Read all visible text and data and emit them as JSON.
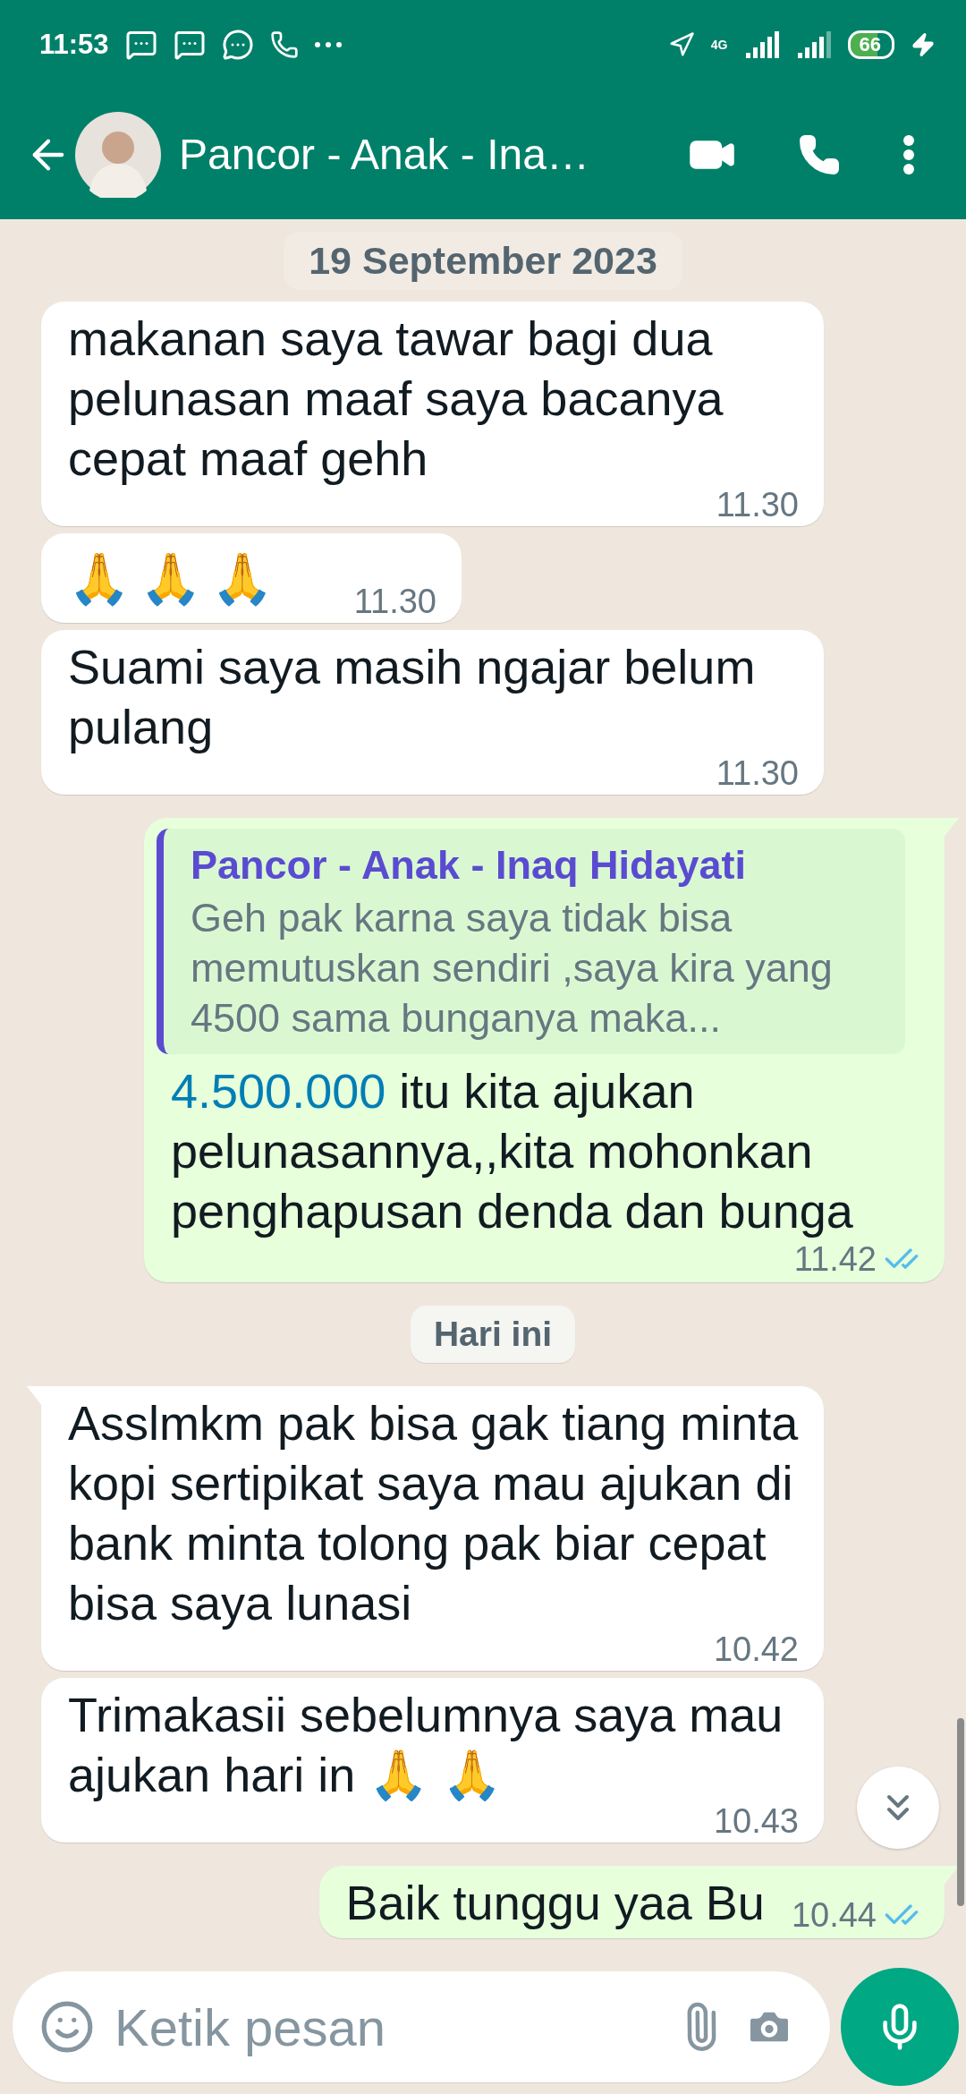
{
  "status_bar": {
    "time": "11:53",
    "network": "4G",
    "battery": "66"
  },
  "header": {
    "title": "Pancor - Anak - Ina…"
  },
  "sticky_date": "19 September 2023",
  "messages": [
    {
      "kind": "text",
      "outgoing": false,
      "text": "makanan saya tawar bagi dua pelunasan maaf saya bacanya cepat maaf gehh",
      "time": "11.30"
    },
    {
      "kind": "emoji",
      "outgoing": false,
      "text": "🙏 🙏 🙏",
      "time": "11.30"
    },
    {
      "kind": "text",
      "outgoing": false,
      "text": "Suami saya masih ngajar belum pulang",
      "time": "11.30"
    },
    {
      "kind": "reply",
      "outgoing": true,
      "tail": true,
      "quote": {
        "author": "Pancor - Anak - Inaq Hidayati",
        "text": "Geh pak karna saya tidak bisa memutuskan sendiri ,saya kira yang 4500 sama bunganya  maka..."
      },
      "link": "4.500.000",
      "text": "itu kita ajukan pelunasannya,,kita mohonkan penghapusan denda dan bunga",
      "time": "11.42",
      "read": true
    },
    {
      "kind": "date",
      "text": "Hari ini"
    },
    {
      "kind": "text",
      "outgoing": false,
      "tail": true,
      "text": "Asslmkm pak bisa gak tiang minta kopi sertipikat saya mau ajukan di bank minta tolong pak biar cepat bisa saya lunasi",
      "time": "10.42"
    },
    {
      "kind": "text",
      "outgoing": false,
      "text": "Trimakasii sebelumnya saya mau ajukan hari in 🙏 🙏",
      "time": "10.43"
    },
    {
      "kind": "text",
      "outgoing": true,
      "tail": true,
      "text": "Baik tunggu yaa Bu",
      "time": "10.44",
      "read": true
    }
  ],
  "composer": {
    "placeholder": "Ketik pesan"
  }
}
